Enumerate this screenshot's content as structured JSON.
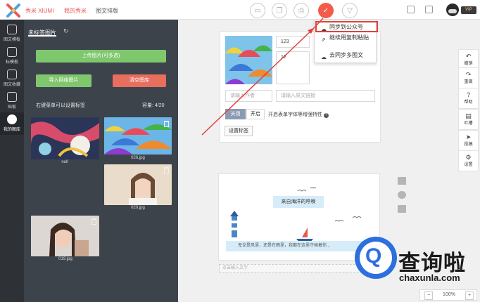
{
  "topbar": {
    "brand": "秀米 XIUMI",
    "nav_my": "我的秀米",
    "nav_layout": "图文排版",
    "vip_badge": "VIP"
  },
  "dropdown": {
    "items": [
      {
        "label": "同步到公众号",
        "icon": "cloud-upload-icon"
      },
      {
        "label": "继续用复制粘贴",
        "icon": "external-link-icon"
      },
      {
        "label": "去同步多图文",
        "icon": "cloud-upload-icon"
      }
    ]
  },
  "rail": {
    "items": [
      {
        "label": "图文模板"
      },
      {
        "label": "标模板"
      },
      {
        "label": "图文收藏"
      },
      {
        "label": "贴板"
      },
      {
        "label": "我的图库"
      }
    ]
  },
  "panel": {
    "tab": "未标签图片",
    "upload_button": "上传图片(可多选)",
    "import_button": "导入网络图片",
    "clear_button": "清空图库",
    "hint": "右键菜单可以设置标签",
    "capacity": "容量: 4/20",
    "images": [
      {
        "label": "null"
      },
      {
        "label": "026.jpg"
      },
      {
        "label": "020.jpg"
      },
      {
        "label": "019.jpg"
      }
    ]
  },
  "editor": {
    "field_1": "123",
    "field_2": "12",
    "author_placeholder": "请输入作者",
    "link_placeholder": "请输入原文链接",
    "toggle_off": "关闭",
    "toggle_on": "开启",
    "toggle_desc": "开启表单字体等增强特性",
    "tag_button": "设置标签",
    "banner": "来自海洋的呼唤",
    "quote": "无论是风里，还是在雨里，我都在这里守候着你...",
    "text_placeholder": "点击输入文字"
  },
  "right_toolbar": {
    "items": [
      {
        "label": "撤销",
        "icon": "undo-icon"
      },
      {
        "label": "重做",
        "icon": "redo-icon"
      },
      {
        "label": "帮助",
        "icon": "help-icon"
      },
      {
        "label": "吐槽",
        "icon": "comment-icon"
      },
      {
        "label": "投稿",
        "icon": "send-icon"
      },
      {
        "label": "设置",
        "icon": "gear-icon"
      }
    ]
  },
  "zoom": {
    "value": "100%",
    "minus": "−",
    "plus": "+"
  },
  "watermark": {
    "cn": "查询啦",
    "en": "chaxunla.com",
    "letter": "Q"
  },
  "colors": {
    "accent": "#f45b4b",
    "green": "#7ec76d",
    "panel": "#3d434b",
    "rail": "#2e3237",
    "highlight": "#e0413a"
  }
}
